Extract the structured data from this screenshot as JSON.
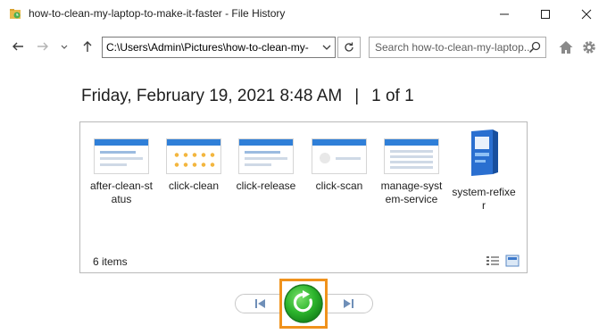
{
  "window": {
    "title": "how-to-clean-my-laptop-to-make-it-faster - File History"
  },
  "nav": {
    "address": "C:\\Users\\Admin\\Pictures\\how-to-clean-my-",
    "search_placeholder": "Search how-to-clean-my-laptop..."
  },
  "header": {
    "date": "Friday, February 19, 2021 8:48 AM",
    "separator": "|",
    "page": "1 of 1"
  },
  "files": [
    {
      "name": "after-clean-status",
      "thumb": "window"
    },
    {
      "name": "click-clean",
      "thumb": "grid"
    },
    {
      "name": "click-release",
      "thumb": "window"
    },
    {
      "name": "click-scan",
      "thumb": "scan"
    },
    {
      "name": "manage-system-service",
      "thumb": "table"
    },
    {
      "name": "system-refixer",
      "thumb": "box"
    }
  ],
  "status": {
    "count": "6 items"
  },
  "colors": {
    "restore_green": "#2db52d",
    "highlight_orange": "#f0921c",
    "accent_blue": "#2f7fd8"
  }
}
